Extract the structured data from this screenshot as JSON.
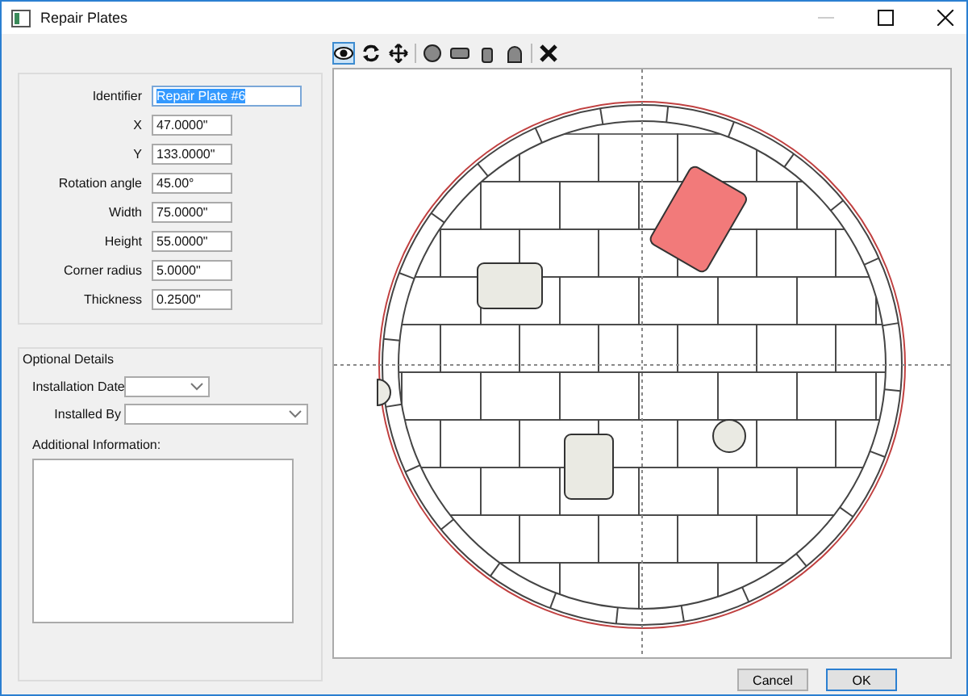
{
  "window": {
    "title": "Repair Plates"
  },
  "toolbar": [
    {
      "kind": "view",
      "selected": true
    },
    {
      "kind": "rotate",
      "selected": false
    },
    {
      "kind": "move",
      "selected": false
    },
    {
      "kind": "sep"
    },
    {
      "kind": "circle",
      "selected": false
    },
    {
      "kind": "slot",
      "selected": false
    },
    {
      "kind": "tall",
      "selected": false
    },
    {
      "kind": "arch",
      "selected": false
    },
    {
      "kind": "sep"
    },
    {
      "kind": "delete",
      "selected": false
    }
  ],
  "properties": [
    {
      "label": "Identifier",
      "value": "Repair Plate #6",
      "selected": true
    },
    {
      "label": "X",
      "value": "47.0000\"",
      "selected": false
    },
    {
      "label": "Y",
      "value": "133.0000\"",
      "selected": false
    },
    {
      "label": "Rotation angle",
      "value": "45.00°",
      "selected": false
    },
    {
      "label": "Width",
      "value": "75.0000\"",
      "selected": false
    },
    {
      "label": "Height",
      "value": "55.0000\"",
      "selected": false
    },
    {
      "label": "Corner radius",
      "value": "5.0000\"",
      "selected": false
    },
    {
      "label": "Thickness",
      "value": "0.2500\"",
      "selected": false
    }
  ],
  "optional_details": {
    "title": "Optional Details",
    "installation_date_label": "Installation Date",
    "installed_by_label": "Installed By",
    "additional_info_label": "Additional Information:"
  },
  "plates": [
    {
      "kind": "rect",
      "selected": true
    },
    {
      "kind": "rect",
      "selected": false
    },
    {
      "kind": "rect",
      "selected": false
    },
    {
      "kind": "circle",
      "selected": false
    },
    {
      "kind": "arch",
      "selected": false
    }
  ],
  "buttons": [
    "Cancel",
    "OK"
  ]
}
